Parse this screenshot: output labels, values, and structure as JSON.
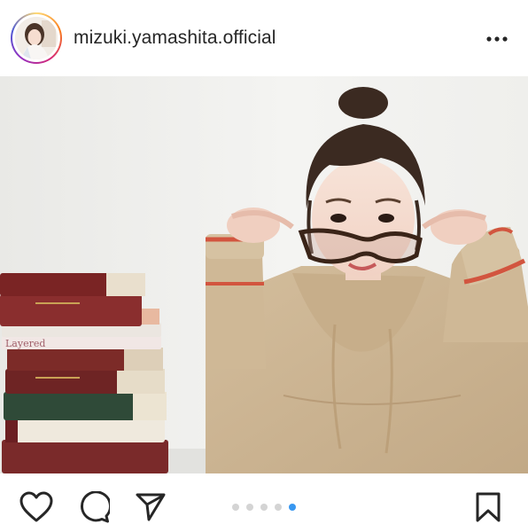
{
  "post": {
    "username": "mizuki.yamashita.official",
    "more_icon": "more-horizontal-icon"
  },
  "photo": {
    "book_spine_text": "Layered",
    "colors": {
      "wall": "#f1f1ef",
      "sweater": "#cbb493",
      "sweater_stripe": "#d2553f",
      "hair": "#3b2a21",
      "glasses": "#3a2418"
    }
  },
  "actions": {
    "like_icon": "heart-icon",
    "comment_icon": "comment-icon",
    "share_icon": "send-icon",
    "save_icon": "bookmark-icon"
  },
  "carousel": {
    "total": 5,
    "active_index": 4,
    "active_color": "#3897f0",
    "inactive_color": "#d4d4d4"
  }
}
